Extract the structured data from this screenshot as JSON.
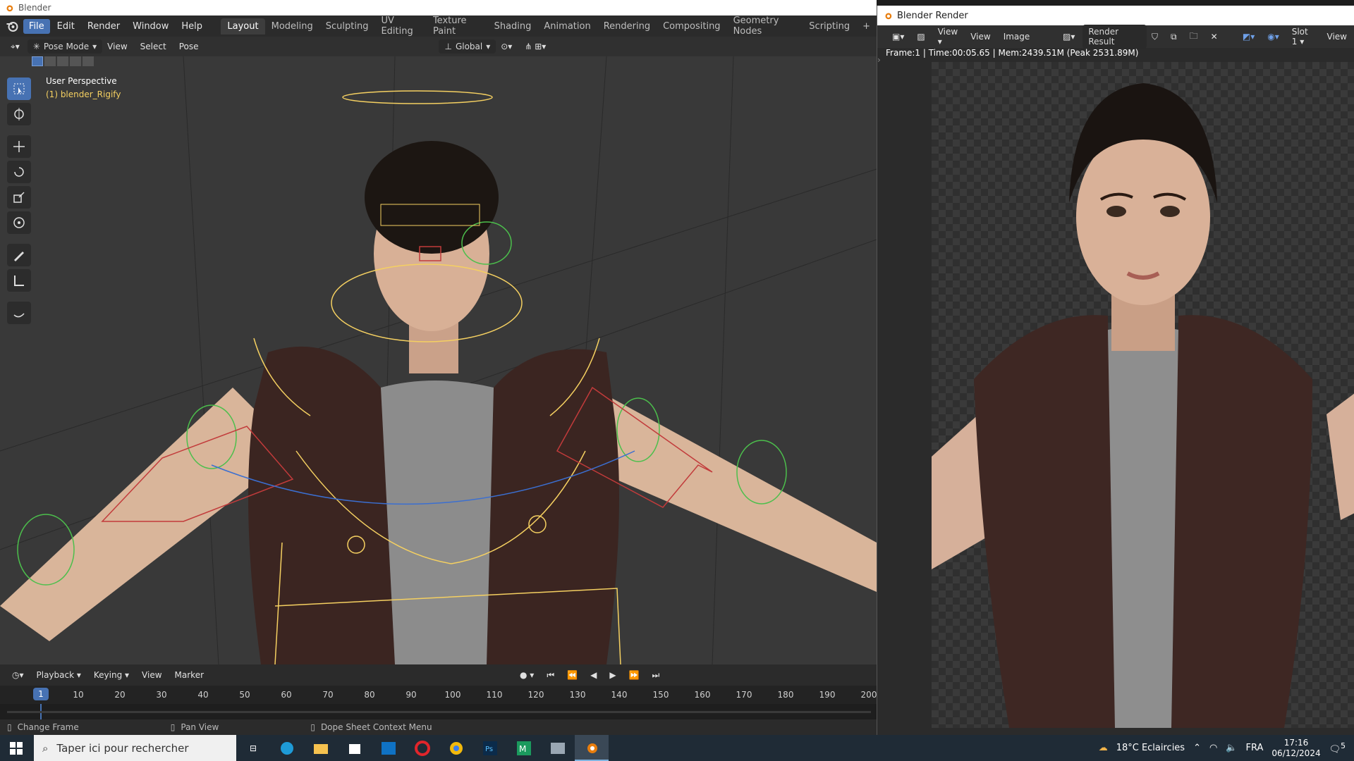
{
  "os_title": "Blender",
  "topbar": {
    "menus": [
      "File",
      "Edit",
      "Render",
      "Window",
      "Help"
    ],
    "workspaces": [
      "Layout",
      "Modeling",
      "Sculpting",
      "UV Editing",
      "Texture Paint",
      "Shading",
      "Animation",
      "Rendering",
      "Compositing",
      "Geometry Nodes",
      "Scripting"
    ],
    "add_tab": "+"
  },
  "viewport_header": {
    "mode": "Pose Mode",
    "menus": [
      "View",
      "Select",
      "Pose"
    ],
    "orientation": "Global"
  },
  "viewport": {
    "info_line1": "User Perspective",
    "info_line2": "(1) blender_Rigify"
  },
  "timeline": {
    "menus": [
      "Playback",
      "Keying",
      "View",
      "Marker"
    ],
    "current_frame": "1",
    "ticks": [
      "10",
      "20",
      "30",
      "40",
      "50",
      "60",
      "70",
      "80",
      "90",
      "100",
      "110",
      "120",
      "130",
      "140",
      "150",
      "160",
      "170",
      "180",
      "190",
      "200"
    ]
  },
  "statusbar": {
    "items": [
      "Change Frame",
      "Pan View",
      "Dope Sheet Context Menu"
    ]
  },
  "render_window": {
    "title": "Blender Render",
    "menus": [
      "View",
      "View",
      "Image"
    ],
    "result": "Render Result",
    "slot": "Slot 1",
    "extra": "View",
    "info": "Frame:1 | Time:00:05.65 | Mem:2439.51M (Peak 2531.89M)"
  },
  "taskbar": {
    "search_placeholder": "Taper ici pour rechercher",
    "apps": [
      "task-view",
      "edge",
      "file-explorer",
      "store",
      "outlook",
      "opera",
      "chrome",
      "photoshop",
      "malwarebytes",
      "app-window",
      "blender"
    ],
    "weather": "18°C  Eclaircies",
    "language": "FRA",
    "time": "17:16",
    "date": "06/12/2024",
    "notifications": "5"
  },
  "colors": {
    "accent": "#4772b3",
    "selected_bone": "#f5d061",
    "viewport_bg": "#393939"
  }
}
